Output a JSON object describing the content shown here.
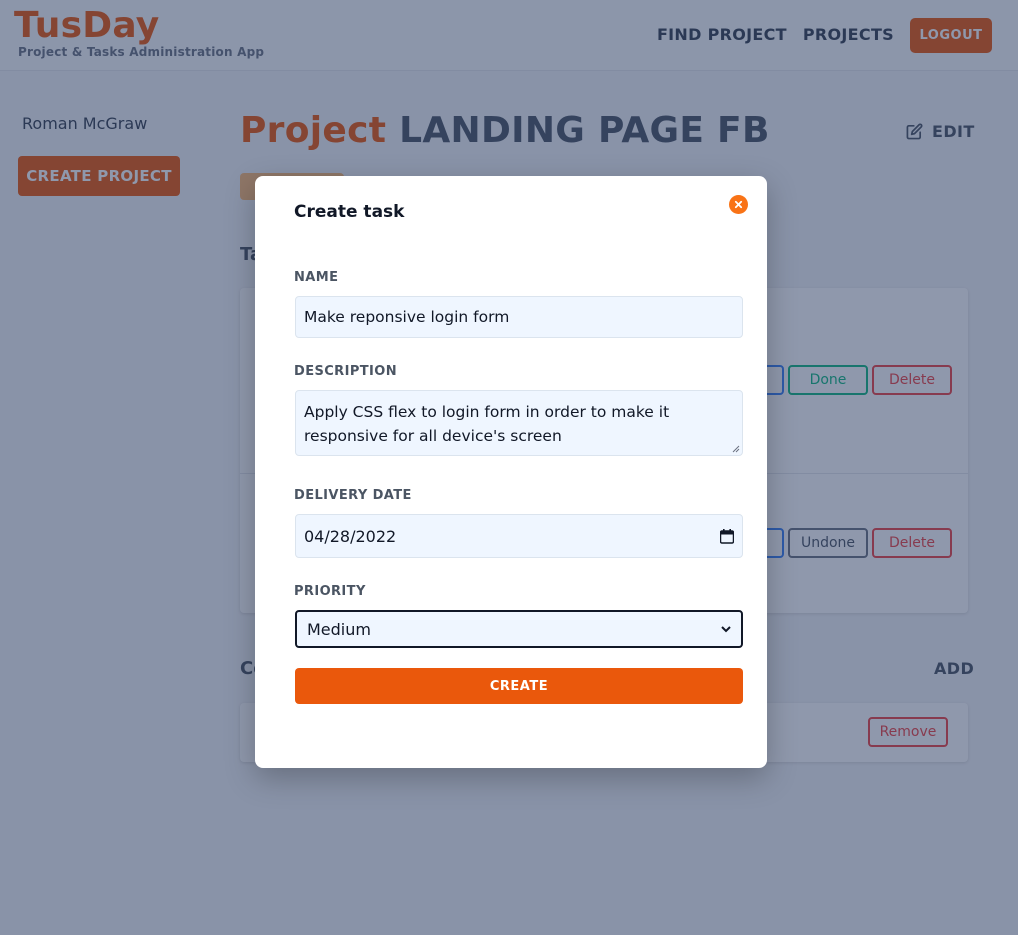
{
  "header": {
    "brand_title": "TusDay",
    "brand_subtitle": "Project & Tasks Administration App",
    "nav_find_project": "FIND PROJECT",
    "nav_projects": "PROJECTS",
    "logout_label": "LOGOUT"
  },
  "sidebar": {
    "user_name": "Roman McGraw",
    "create_project_label": "CREATE PROJECT"
  },
  "main": {
    "project_label": "Project",
    "project_name": "LANDING PAGE FB",
    "edit_label": "EDIT",
    "tasks": [
      {
        "done_label": "Done",
        "delete_label": "Delete"
      },
      {
        "done_label": "Undone",
        "delete_label": "Delete"
      }
    ],
    "collaborators_add_label": "ADD",
    "collaborator_remove_label": "Remove"
  },
  "modal": {
    "title": "Create task",
    "name_label": "NAME",
    "name_value": "Make reponsive login form",
    "description_label": "DESCRIPTION",
    "description_value": "Apply CSS flex to login form in order to make it responsive for all device's screen",
    "delivery_date_label": "DELIVERY DATE",
    "delivery_date_value": "04/28/2022",
    "priority_label": "PRIORITY",
    "priority_value": "Medium",
    "create_label": "CREATE"
  },
  "colors": {
    "accent": "#ea580c",
    "overlay": "#1f325a"
  }
}
